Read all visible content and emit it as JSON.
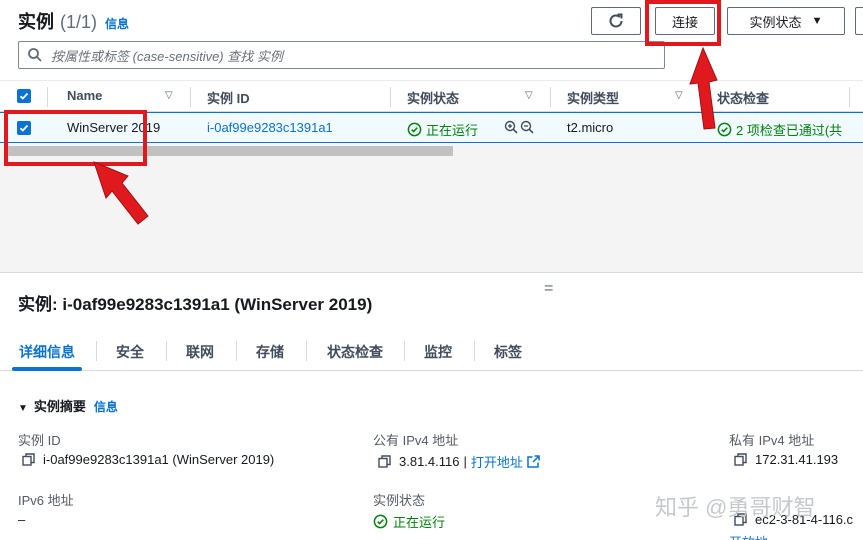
{
  "header": {
    "title": "实例",
    "count": "(1/1)",
    "info": "信息",
    "connect_label": "连接",
    "instance_state_label": "实例状态",
    "search_placeholder": "按属性或标签 (case-sensitive) 查找 实例"
  },
  "table": {
    "columns": [
      "Name",
      "实例 ID",
      "实例状态",
      "实例类型",
      "状态检查"
    ],
    "rows": [
      {
        "name": "WinServer 2019",
        "instance_id": "i-0af99e9283c1391a1",
        "state": "正在运行",
        "type": "t2.micro",
        "status_check": "2 项检查已通过(共"
      }
    ]
  },
  "details": {
    "title": "实例: i-0af99e9283c1391a1 (WinServer 2019)",
    "tabs": [
      "详细信息",
      "安全",
      "联网",
      "存储",
      "状态检查",
      "监控",
      "标签"
    ],
    "active_tab": "详细信息",
    "section_title": "实例摘要",
    "section_info": "信息",
    "fields": {
      "instance_id_label": "实例 ID",
      "instance_id_value": "i-0af99e9283c1391a1 (WinServer 2019)",
      "public_ipv4_label": "公有 IPv4 地址",
      "public_ipv4_value": "3.81.4.116",
      "public_ipv4_sep": "|",
      "open_address": "打开地址",
      "private_ipv4_label": "私有 IPv4 地址",
      "private_ipv4_value": "172.31.41.193",
      "ipv6_label": "IPv6 地址",
      "ipv6_value": "–",
      "state_label": "实例状态",
      "state_value": "正在运行",
      "public_dns_partial": "ec2-3-81-4-116.c",
      "open_address_partial": "开放地"
    }
  },
  "watermark": "知乎 @勇哥财智",
  "colors": {
    "link": "#0972d3",
    "success": "#037f0c",
    "annotation": "#e0191e"
  },
  "icons": [
    "search-icon",
    "refresh-icon",
    "checkbox-icon",
    "sort-icon",
    "success-icon",
    "zoom-in-icon",
    "zoom-out-icon",
    "copy-icon",
    "external-link-icon"
  ]
}
